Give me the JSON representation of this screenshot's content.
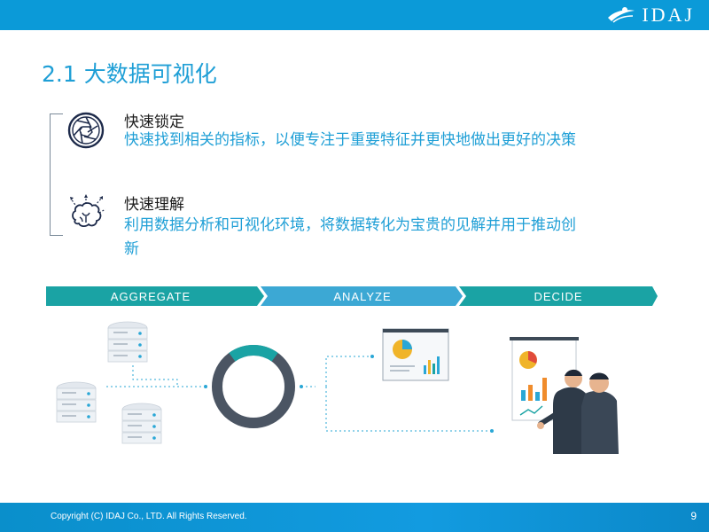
{
  "brand": {
    "logo_text": "IDAJ",
    "color": "#0b9ad8"
  },
  "slide": {
    "title": "2.1 大数据可视化",
    "page_number": "9"
  },
  "items": [
    {
      "title": "快速锁定",
      "description": "快速找到相关的指标，以便专注于重要特征并更快地做出更好的决策",
      "icon": "aperture-icon"
    },
    {
      "title": "快速理解",
      "description_line1": "利用数据分析和可视化环境，将数据转化为宝贵的见解并用于推动创",
      "description_line2": "新",
      "icon": "brain-icon"
    }
  ],
  "process": {
    "steps": [
      "AGGREGATE",
      "ANALYZE",
      "DECIDE"
    ],
    "colors": [
      "#1aa3a4",
      "#3ca8d4",
      "#1aa3a4"
    ]
  },
  "donut": {
    "highlight_fraction": 0.2,
    "highlight_color": "#1aa3a4",
    "base_color": "#4b5563"
  },
  "footer": {
    "copyright": "Copyright (C)  IDAJ Co., LTD. All Rights Reserved."
  }
}
